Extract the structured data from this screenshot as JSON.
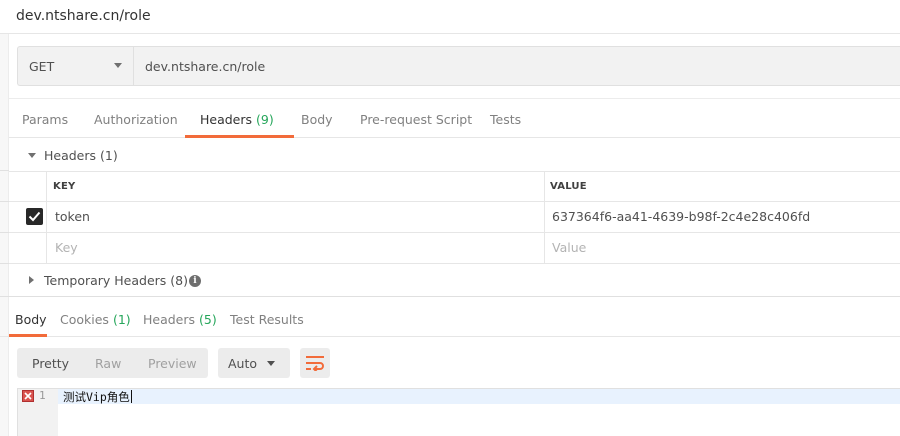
{
  "title": "dev.ntshare.cn/role",
  "request": {
    "method": "GET",
    "url": "dev.ntshare.cn/role"
  },
  "request_tabs": [
    {
      "label": "Params",
      "count": ""
    },
    {
      "label": "Authorization",
      "count": ""
    },
    {
      "label": "Headers",
      "count": "(9)"
    },
    {
      "label": "Body",
      "count": ""
    },
    {
      "label": "Pre-request Script",
      "count": ""
    },
    {
      "label": "Tests",
      "count": ""
    }
  ],
  "active_request_tab": "Headers",
  "headers_section": {
    "title": "Headers (1)",
    "columns": {
      "key": "KEY",
      "value": "VALUE"
    },
    "rows": [
      {
        "checked": true,
        "key": "token",
        "value": "637364f6-aa41-4639-b98f-2c4e28c406fd"
      }
    ],
    "placeholder": {
      "key": "Key",
      "value": "Value"
    },
    "temporary_title": "Temporary Headers (8)",
    "info_glyph": "i"
  },
  "response_tabs": [
    {
      "label": "Body",
      "count": ""
    },
    {
      "label": "Cookies",
      "count": "(1)"
    },
    {
      "label": "Headers",
      "count": "(5)"
    },
    {
      "label": "Test Results",
      "count": ""
    }
  ],
  "active_response_tab": "Body",
  "view_modes": [
    "Pretty",
    "Raw",
    "Preview"
  ],
  "active_view_mode": "Pretty",
  "format": "Auto",
  "editor": {
    "line_number": "1",
    "content": "测试Vip角色",
    "has_error_marker": true
  },
  "colors": {
    "accent": "#f26b3a",
    "count_green": "#26a65b",
    "error_red": "#d9534f"
  }
}
